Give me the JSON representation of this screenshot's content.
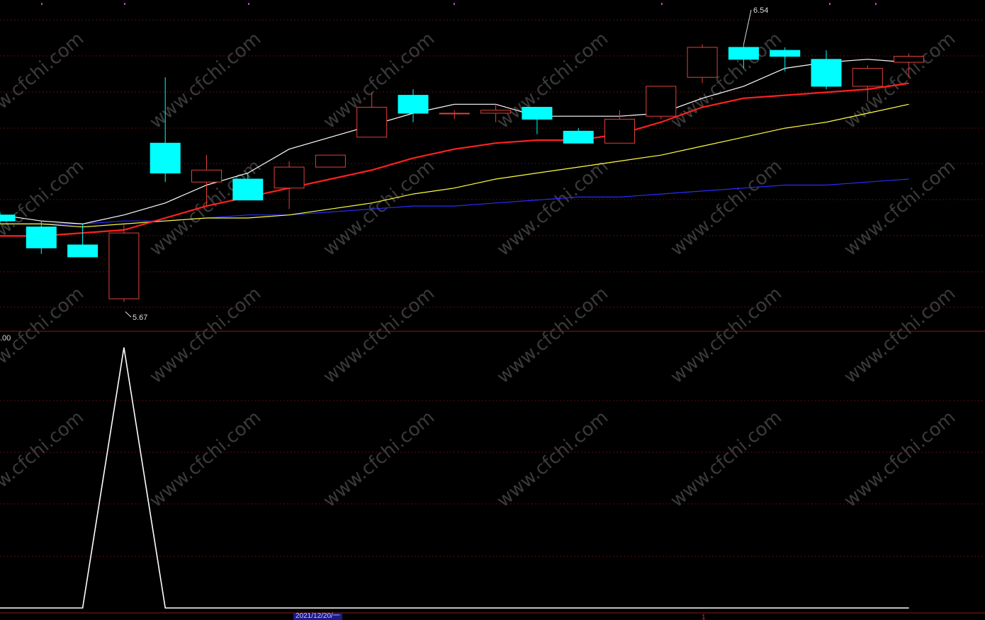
{
  "chart_data": [
    {
      "type": "candlestick",
      "colors": {
        "up": "#e0413a",
        "down": "#00ffff",
        "ma5": "#ffffff",
        "ma10": "#ff2020",
        "ma20": "#ffff40",
        "ma60": "#2b2bff"
      },
      "candles": [
        {
          "o": 5.96,
          "h": 5.97,
          "c": 5.94,
          "l": 5.93
        },
        {
          "o": 5.92,
          "h": 5.94,
          "c": 5.85,
          "l": 5.83
        },
        {
          "o": 5.86,
          "h": 5.93,
          "c": 5.82,
          "l": 5.82
        },
        {
          "o": 5.68,
          "h": 5.93,
          "c": 5.9,
          "l": 5.67
        },
        {
          "o": 6.2,
          "h": 6.42,
          "c": 6.1,
          "l": 6.07
        },
        {
          "o": 6.07,
          "h": 6.16,
          "c": 6.11,
          "l": 5.99
        },
        {
          "o": 6.08,
          "h": 6.1,
          "c": 6.01,
          "l": 6.01
        },
        {
          "o": 6.05,
          "h": 6.14,
          "c": 6.12,
          "l": 5.98
        },
        {
          "o": 6.12,
          "h": 6.16,
          "c": 6.16,
          "l": 6.12
        },
        {
          "o": 6.22,
          "h": 6.37,
          "c": 6.32,
          "l": 6.22
        },
        {
          "o": 6.36,
          "h": 6.38,
          "c": 6.3,
          "l": 6.27
        },
        {
          "o": 6.3,
          "h": 6.31,
          "c": 6.3,
          "l": 6.28
        },
        {
          "o": 6.3,
          "h": 6.33,
          "c": 6.31,
          "l": 6.27
        },
        {
          "o": 6.32,
          "h": 6.32,
          "c": 6.28,
          "l": 6.23
        },
        {
          "o": 6.24,
          "h": 6.25,
          "c": 6.2,
          "l": 6.2
        },
        {
          "o": 6.2,
          "h": 6.31,
          "c": 6.28,
          "l": 6.2
        },
        {
          "o": 6.29,
          "h": 6.39,
          "c": 6.39,
          "l": 6.28
        },
        {
          "o": 6.42,
          "h": 6.53,
          "c": 6.52,
          "l": 6.4
        },
        {
          "o": 6.52,
          "h": 6.53,
          "c": 6.48,
          "l": 6.45
        },
        {
          "o": 6.51,
          "h": 6.52,
          "c": 6.49,
          "l": 6.44
        },
        {
          "o": 6.48,
          "h": 6.51,
          "c": 6.39,
          "l": 6.38
        },
        {
          "o": 6.39,
          "h": 6.46,
          "c": 6.45,
          "l": 6.34
        },
        {
          "o": 6.47,
          "h": 6.5,
          "c": 6.49,
          "l": 6.42
        }
      ],
      "ma5": [
        5.96,
        5.94,
        5.93,
        5.96,
        6.0,
        6.06,
        6.1,
        6.18,
        6.22,
        6.26,
        6.3,
        6.33,
        6.33,
        6.29,
        6.29,
        6.29,
        6.3,
        6.35,
        6.39,
        6.45,
        6.47,
        6.48,
        6.47
      ],
      "ma10": [
        5.89,
        5.89,
        5.9,
        5.91,
        5.95,
        5.99,
        6.02,
        6.05,
        6.08,
        6.11,
        6.15,
        6.18,
        6.2,
        6.21,
        6.21,
        6.23,
        6.27,
        6.32,
        6.35,
        6.36,
        6.37,
        6.38,
        6.4
      ],
      "ma20": [
        5.93,
        5.93,
        5.92,
        5.93,
        5.94,
        5.95,
        5.95,
        5.96,
        5.98,
        6.0,
        6.03,
        6.05,
        6.08,
        6.1,
        6.12,
        6.14,
        6.16,
        6.19,
        6.22,
        6.25,
        6.27,
        6.3,
        6.33
      ],
      "ma60": [
        5.93,
        5.93,
        5.93,
        5.94,
        5.94,
        5.95,
        5.96,
        5.96,
        5.97,
        5.98,
        5.99,
        5.99,
        6.0,
        6.01,
        6.02,
        6.02,
        6.03,
        6.04,
        6.05,
        6.06,
        6.06,
        6.07,
        6.08
      ],
      "ylim": [
        5.6,
        6.56
      ],
      "annotations": {
        "high_label": "6.54",
        "low_label": "5.67"
      }
    },
    {
      "type": "line",
      "color": "#ffffff",
      "values": [
        0,
        0,
        0,
        1,
        0,
        0,
        0,
        0,
        0,
        0,
        0,
        0,
        0,
        0,
        0,
        0,
        0,
        0,
        0,
        0,
        0,
        0,
        0
      ],
      "ylim": [
        0,
        1.0
      ],
      "top_label": ".00"
    }
  ],
  "footer": {
    "date_label": "2021/12/20/一",
    "right_marker": "1"
  },
  "watermark": "www.cfchi.com"
}
